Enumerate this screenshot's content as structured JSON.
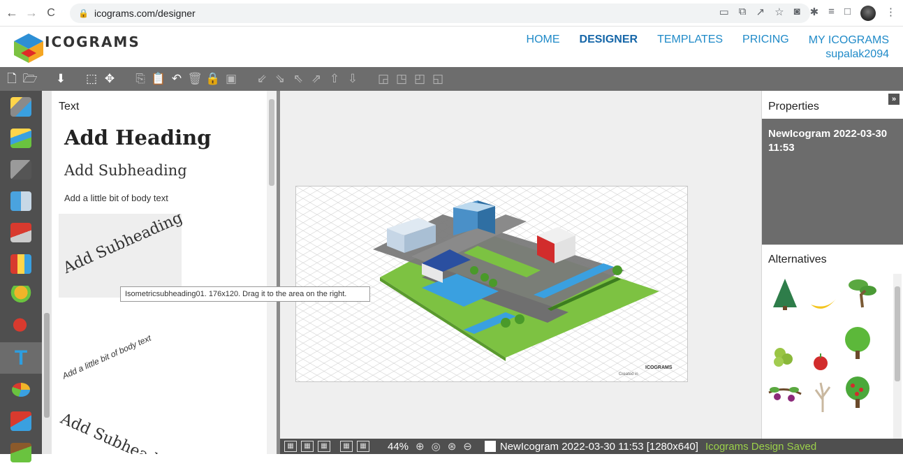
{
  "browser": {
    "url": "icograms.com/designer",
    "back": "←",
    "forward": "→",
    "reload": "C"
  },
  "header": {
    "logo_text": "ICOGRAMS",
    "nav": {
      "home": "HOME",
      "designer": "DESIGNER",
      "templates": "TEMPLATES",
      "pricing": "PRICING",
      "my": "MY ICOGRAMS",
      "user": "supalak2094"
    }
  },
  "text_panel": {
    "title": "Text",
    "heading": "Add Heading",
    "subheading": "Add Subheading",
    "body": "Add a little bit of body text",
    "iso_subheading": "Add Subheading",
    "iso_body": "Add a little bit of body text",
    "iso_subheading_2": "Add Subheading"
  },
  "tooltip": "Isometricsubheading01. 176x120. Drag it to the area on the right.",
  "canvas": {
    "created_in": "Created in",
    "logo": "ICOGRAMS"
  },
  "properties": {
    "title": "Properties",
    "collapse": "»",
    "name": "NewIcogram 2022-03-30 11:53"
  },
  "alternatives": {
    "title": "Alternatives",
    "items": [
      "fir-tree-icon",
      "bananas-icon",
      "bonsai-tree-icon",
      "grapes-icon",
      "apple-icon",
      "round-tree-icon",
      "grape-vine-icon",
      "bare-tree-icon",
      "apple-tree-icon"
    ]
  },
  "status": {
    "zoom": "44%",
    "document": "NewIcogram 2022-03-30 11:53 [1280x640]",
    "saved": "Icograms Design Saved"
  },
  "colors": {
    "accent": "#1f8ac8",
    "toolbar": "#6d6d6d",
    "sidebar": "#4f4f4f",
    "saved": "#9bd04a"
  }
}
